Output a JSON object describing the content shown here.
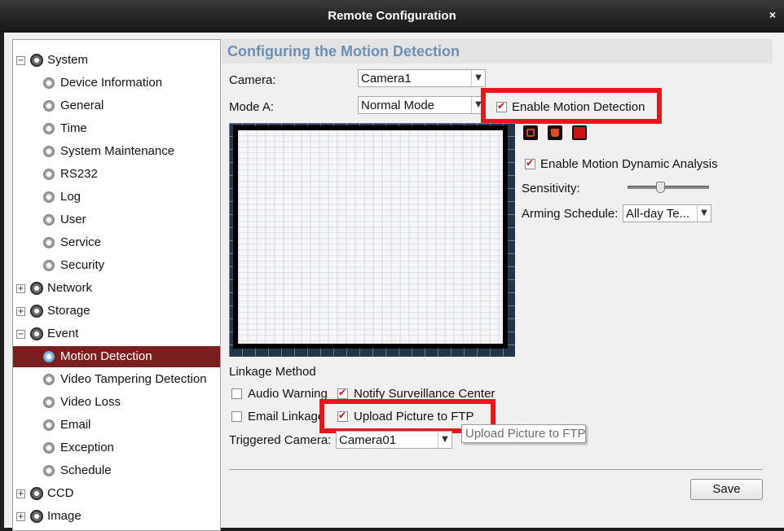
{
  "window": {
    "title": "Remote Configuration",
    "close_glyph": "×"
  },
  "tree": {
    "collapse_glyph": "−",
    "expand_glyph": "+",
    "items": [
      {
        "label": "System"
      },
      {
        "label": "Device Information"
      },
      {
        "label": "General"
      },
      {
        "label": "Time"
      },
      {
        "label": "System Maintenance"
      },
      {
        "label": "RS232"
      },
      {
        "label": "Log"
      },
      {
        "label": "User"
      },
      {
        "label": "Service"
      },
      {
        "label": "Security"
      },
      {
        "label": "Network"
      },
      {
        "label": "Storage"
      },
      {
        "label": "Event"
      },
      {
        "label": "Motion Detection"
      },
      {
        "label": "Video Tampering Detection"
      },
      {
        "label": "Video Loss"
      },
      {
        "label": "Email"
      },
      {
        "label": "Exception"
      },
      {
        "label": "Schedule"
      },
      {
        "label": "CCD"
      },
      {
        "label": "Image"
      }
    ],
    "selected": "Motion Detection"
  },
  "main": {
    "heading": "Configuring the Motion Detection",
    "camera_label": "Camera:",
    "camera_value": "Camera1",
    "mode_label": "Mode A:",
    "mode_value": "Normal Mode",
    "enable_motion_detection": {
      "label": "Enable Motion Detection",
      "checked": true
    },
    "enable_dynamic_analysis": {
      "label": "Enable Motion Dynamic Analysis",
      "checked": true
    },
    "sensitivity_label": "Sensitivity:",
    "sensitivity_level": 0.4,
    "arming_label": "Arming Schedule:",
    "arming_value": "All-day Te...",
    "linkage_label": "Linkage Method",
    "audio_warning": {
      "label": "Audio Warning",
      "checked": false
    },
    "notify_center": {
      "label": "Notify Surveillance Center",
      "checked": true
    },
    "email_linkage": {
      "label": "Email Linkage",
      "checked": false
    },
    "upload_ftp": {
      "label": "Upload Picture to FTP",
      "checked": true
    },
    "triggered_label": "Triggered Camera:",
    "triggered_value": "Camera01",
    "tooltip": "Upload Picture to FTP",
    "save_label": "Save"
  },
  "colors": {
    "highlight_box": "#e8161d",
    "selected_row": "#7a1f1f",
    "heading_text": "#6d8fb5",
    "checkmark": "#b11212"
  },
  "icons": {
    "dropdown": "chevron-down-icon",
    "tree_branch": "gear-icon",
    "tools": [
      "draw-area-icon",
      "delete-icon",
      "stop-icon"
    ]
  }
}
